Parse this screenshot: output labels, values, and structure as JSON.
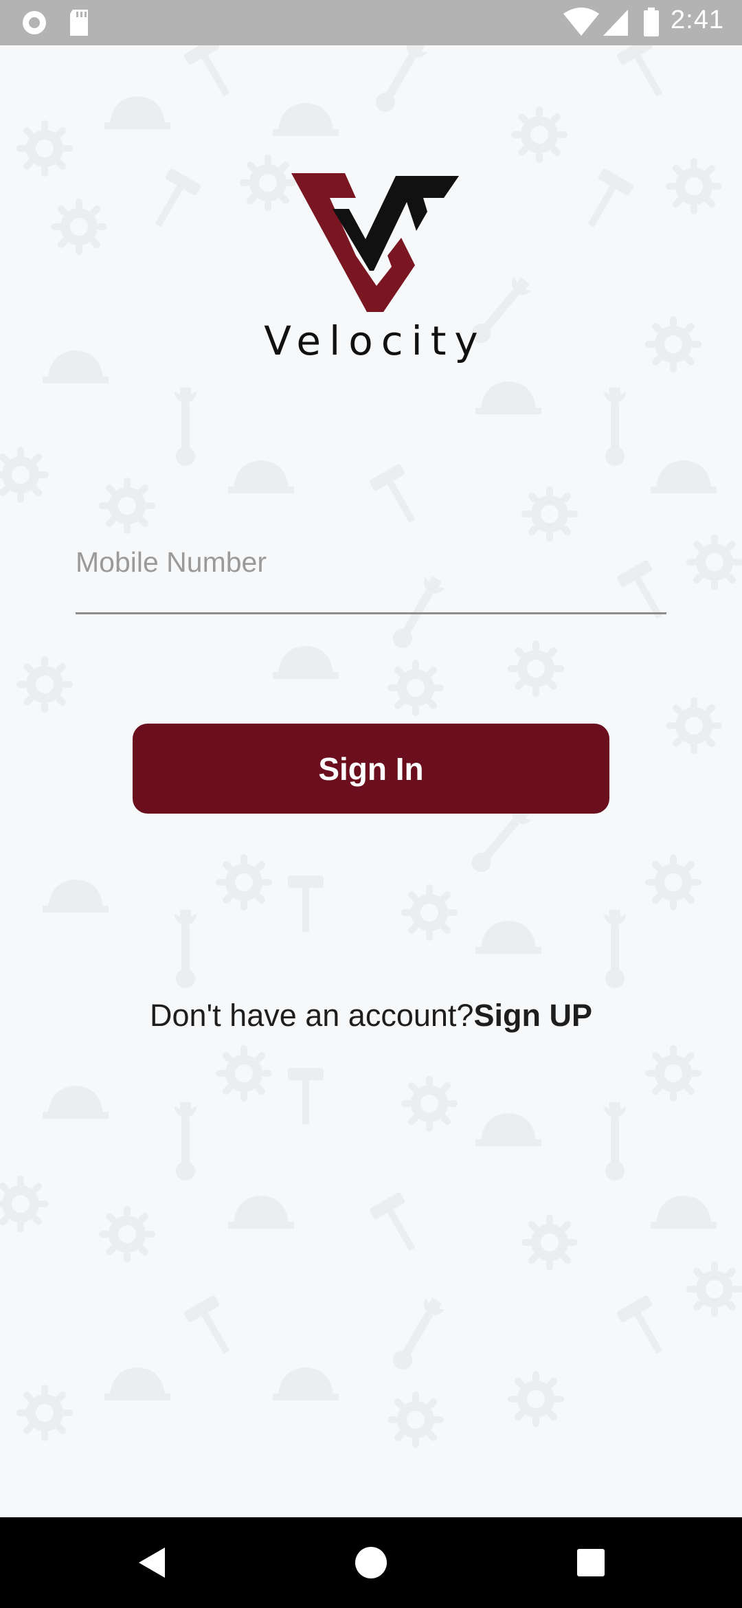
{
  "status_bar": {
    "time": "2:41",
    "icons": [
      "record-icon",
      "sd-card-icon",
      "wifi-icon",
      "cell-signal-icon",
      "battery-icon"
    ]
  },
  "brand": {
    "name": "Velocity",
    "logo_colors": {
      "maroon": "#7a1522",
      "black": "#111111"
    }
  },
  "login_form": {
    "mobile_placeholder": "Mobile Number",
    "mobile_value": "",
    "sign_in_label": "Sign In"
  },
  "signup": {
    "prompt": "Don't have an account?",
    "link_label": "Sign UP"
  },
  "nav_bar": {
    "buttons": [
      "back-icon",
      "home-icon",
      "recents-icon"
    ]
  },
  "colors": {
    "accent": "#6b0f1e",
    "background": "#f7f8f9",
    "status_bar": "#b3b3b3",
    "nav_bar": "#000000"
  }
}
